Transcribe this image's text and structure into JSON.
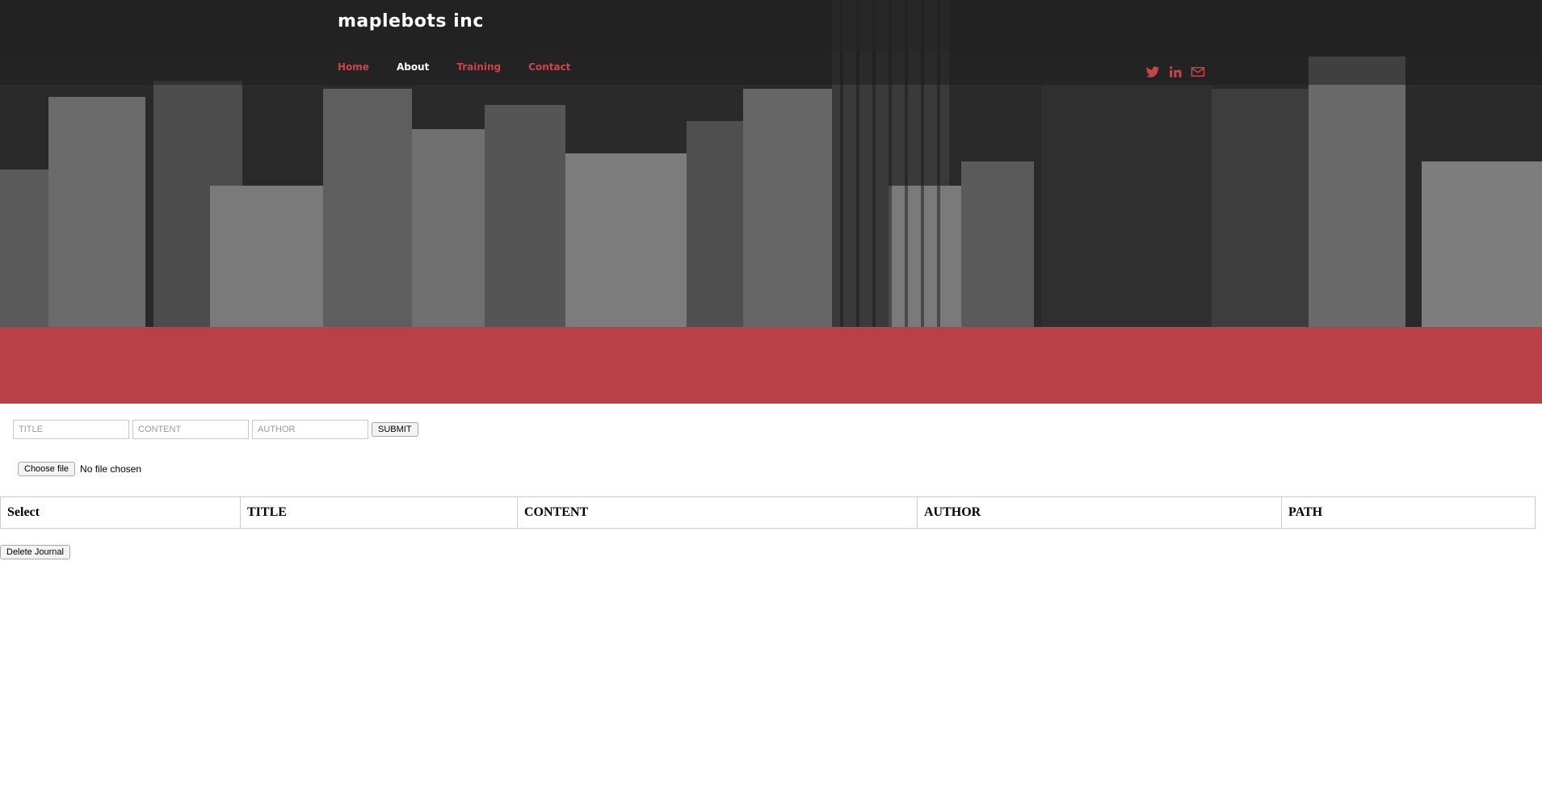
{
  "header": {
    "brand": "maplebots inc",
    "nav": [
      {
        "label": "Home",
        "active": false
      },
      {
        "label": "About",
        "active": true
      },
      {
        "label": "Training",
        "active": false
      },
      {
        "label": "Contact",
        "active": false
      }
    ],
    "social_icons": [
      "twitter-icon",
      "linkedin-icon",
      "mail-icon"
    ]
  },
  "colors": {
    "accent": "#b94046",
    "nav_link": "#c9454d"
  },
  "form": {
    "title_placeholder": "TITLE",
    "content_placeholder": "CONTENT",
    "author_placeholder": "AUTHOR",
    "submit_label": "SUBMIT",
    "file_button_label": "Choose file",
    "file_status": "No file chosen"
  },
  "table": {
    "columns": [
      "Select",
      "TITLE",
      "CONTENT",
      "AUTHOR",
      "PATH"
    ]
  },
  "actions": {
    "delete_label": "Delete Journal"
  }
}
